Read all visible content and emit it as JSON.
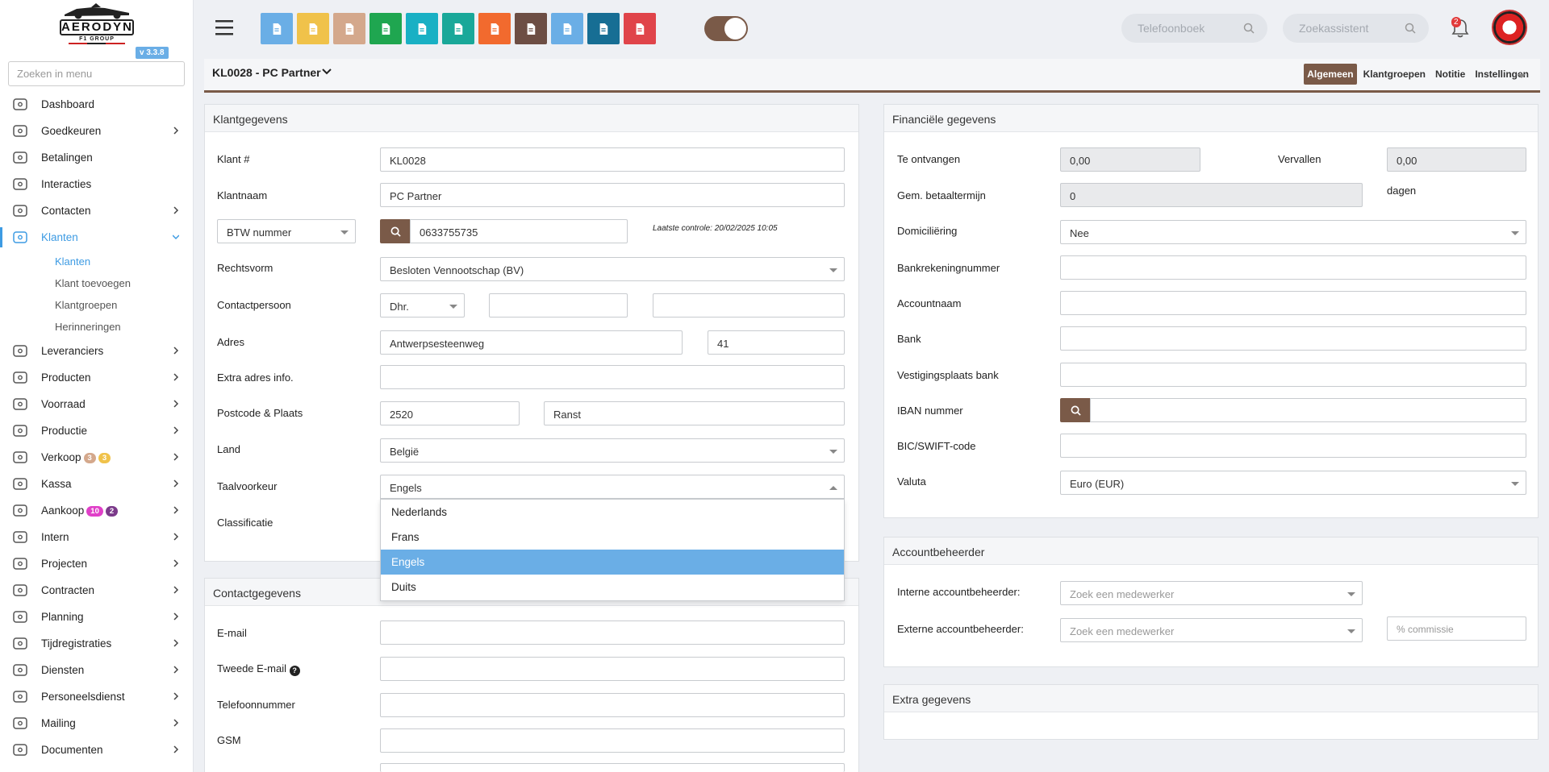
{
  "app": {
    "version": "v 3.3.8",
    "logo_text": "AERODYN",
    "logo_sub": "F1 GROUP"
  },
  "sidebar": {
    "search_placeholder": "Zoeken in menu",
    "items": [
      {
        "label": "Dashboard",
        "icon": "dashboard-icon",
        "chevron": false
      },
      {
        "label": "Goedkeuren",
        "icon": "user-check-icon",
        "chevron": true
      },
      {
        "label": "Betalingen",
        "icon": "credit-card-icon",
        "chevron": false
      },
      {
        "label": "Interacties",
        "icon": "chat-icon",
        "chevron": false
      },
      {
        "label": "Contacten",
        "icon": "contact-card-icon",
        "chevron": true
      },
      {
        "label": "Klanten",
        "icon": "user-icon",
        "chevron": true,
        "active": true,
        "expanded": true,
        "children": [
          "Klanten",
          "Klant toevoegen",
          "Klantgroepen",
          "Herinneringen"
        ]
      },
      {
        "label": "Leveranciers",
        "icon": "truck-icon",
        "chevron": true
      },
      {
        "label": "Producten",
        "icon": "box-icon",
        "chevron": true
      },
      {
        "label": "Voorraad",
        "icon": "boxes-icon",
        "chevron": true
      },
      {
        "label": "Productie",
        "icon": "gears-icon",
        "chevron": true
      },
      {
        "label": "Verkoop",
        "icon": "euro-icon",
        "chevron": true,
        "badges": [
          {
            "text": "3",
            "color": "#d4a88c"
          },
          {
            "text": "3",
            "color": "#f0c24a"
          }
        ]
      },
      {
        "label": "Kassa",
        "icon": "basket-icon",
        "chevron": true
      },
      {
        "label": "Aankoop",
        "icon": "cart-icon",
        "chevron": true,
        "badges": [
          {
            "text": "10",
            "color": "#e040c8"
          },
          {
            "text": "2",
            "color": "#7b3a8a"
          }
        ]
      },
      {
        "label": "Intern",
        "icon": "users-icon",
        "chevron": true
      },
      {
        "label": "Projecten",
        "icon": "project-icon",
        "chevron": true
      },
      {
        "label": "Contracten",
        "icon": "contract-icon",
        "chevron": true
      },
      {
        "label": "Planning",
        "icon": "calendar-icon",
        "chevron": true
      },
      {
        "label": "Tijdregistraties",
        "icon": "clock-icon",
        "chevron": true
      },
      {
        "label": "Diensten",
        "icon": "refresh-icon",
        "chevron": true
      },
      {
        "label": "Personeelsdienst",
        "icon": "person-icon",
        "chevron": true
      },
      {
        "label": "Mailing",
        "icon": "paper-plane-icon",
        "chevron": true
      },
      {
        "label": "Documenten",
        "icon": "folder-icon",
        "chevron": true
      }
    ]
  },
  "topbar": {
    "buttons": [
      {
        "name": "new-document-button",
        "color": "#6aaee6",
        "icon": "document-icon"
      },
      {
        "name": "clipboard-yellow-button",
        "color": "#f0c24a",
        "icon": "clipboard-icon"
      },
      {
        "name": "clipboard-tan-button",
        "color": "#d4a88c",
        "icon": "clipboard-icon"
      },
      {
        "name": "spreadsheet-button",
        "color": "#1fa650",
        "icon": "spreadsheet-icon"
      },
      {
        "name": "file-teal-button",
        "color": "#19b0c4",
        "icon": "file-icon"
      },
      {
        "name": "calendar-check-button",
        "color": "#19a899",
        "icon": "calendar-check-icon"
      },
      {
        "name": "chat-button",
        "color": "#f26a2e",
        "icon": "chat-bubbles-icon"
      },
      {
        "name": "mail-button",
        "color": "#6d4e44",
        "icon": "envelope-icon"
      },
      {
        "name": "bell-button",
        "color": "#6aaee6",
        "icon": "bell-icon"
      },
      {
        "name": "user-button",
        "color": "#176e94",
        "icon": "user-icon"
      },
      {
        "name": "delete-button",
        "color": "#e0444a",
        "icon": "trash-icon"
      }
    ],
    "phonebook_placeholder": "Telefoonboek",
    "search_placeholder": "Zoekassistent",
    "notifications_count": "2"
  },
  "page": {
    "title": "KL0028 - PC Partner",
    "tabs": [
      "Algemeen",
      "Klantgroepen",
      "Notitie",
      "Instellingen"
    ],
    "active_tab": "Algemeen"
  },
  "klant": {
    "title": "Klantgegevens",
    "klant_nr_label": "Klant #",
    "klant_nr": "KL0028",
    "klantnaam_label": "Klantnaam",
    "klantnaam": "PC Partner",
    "btw_type": "BTW nummer",
    "btw_nummer": "0633755735",
    "laatste_controle": "Laatste controle: 20/02/2025 10:05",
    "rechtsvorm_label": "Rechtsvorm",
    "rechtsvorm": "Besloten Vennootschap (BV)",
    "contactpersoon_label": "Contactpersoon",
    "aanspreking": "Dhr.",
    "adres_label": "Adres",
    "straat": "Antwerpsesteenweg",
    "huisnummer": "41",
    "extra_adres_label": "Extra adres info.",
    "postcode_label": "Postcode & Plaats",
    "postcode": "2520",
    "plaats": "Ranst",
    "land_label": "Land",
    "land": "België",
    "taal_label": "Taalvoorkeur",
    "taal": "Engels",
    "classificatie_label": "Classificatie",
    "taal_options": [
      "Nederlands",
      "Frans",
      "Engels",
      "Duits"
    ],
    "taal_highlight": "Engels"
  },
  "contact": {
    "title": "Contactgegevens",
    "email_label": "E-mail",
    "email2_label": "Tweede E-mail",
    "telefoon_label": "Telefoonnummer",
    "gsm_label": "GSM"
  },
  "financieel": {
    "title": "Financiële gegevens",
    "te_ontvangen_label": "Te ontvangen",
    "te_ontvangen": "0,00",
    "vervallen_label": "Vervallen",
    "vervallen": "0,00",
    "betaaltermijn_label": "Gem. betaaltermijn",
    "betaaltermijn": "0",
    "dagen": "dagen",
    "domiciliering_label": "Domiciliëring",
    "domiciliering": "Nee",
    "bankrekening_label": "Bankrekeningnummer",
    "accountnaam_label": "Accountnaam",
    "bank_label": "Bank",
    "vestigingsplaats_label": "Vestigingsplaats bank",
    "iban_label": "IBAN nummer",
    "bic_label": "BIC/SWIFT-code",
    "valuta_label": "Valuta",
    "valuta": "Euro (EUR)"
  },
  "accountbeheerder": {
    "title": "Accountbeheerder",
    "intern_label": "Interne accountbeheerder:",
    "extern_label": "Externe accountbeheerder:",
    "placeholder": "Zoek een medewerker",
    "commissie_placeholder": "% commissie"
  },
  "extra": {
    "title": "Extra gegevens"
  },
  "colors": {
    "brand": "#7a5a48",
    "accent": "#3d9be3",
    "highlight": "#6aaee6"
  }
}
